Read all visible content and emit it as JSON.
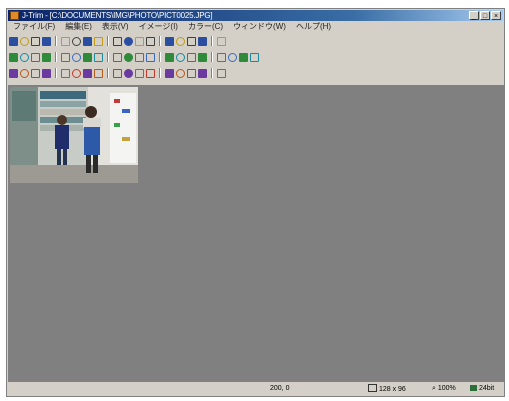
{
  "window": {
    "title": "J-Trim - [C:\\DOCUMENTS\\IMG\\PHOTO\\PICT0025.JPG]",
    "minimize": "_",
    "maximize": "□",
    "close": "×"
  },
  "menu": [
    "ファイル(F)",
    "編集(E)",
    "表示(V)",
    "イメージ(I)",
    "カラー(C)",
    "ウィンドウ(W)",
    "ヘルプ(H)"
  ],
  "toolbars": [
    [
      "new-icon",
      "open-icon",
      "save-icon",
      "print-icon",
      "cut-icon",
      "copy-icon",
      "paste-icon",
      "find-icon",
      "undo-icon",
      "redo-icon",
      "frame-icon",
      "text-icon",
      "line-icon",
      "grid-icon",
      "ruler-icon",
      "eyedropper-icon",
      "color-icon"
    ],
    [
      "select-icon",
      "rotate-icon",
      "flip-h-icon",
      "flip-v-icon",
      "arrow-icon",
      "resize-icon",
      "effect1-icon",
      "effect2-icon",
      "effect3-icon",
      "brightness-icon",
      "contrast-icon",
      "fill-icon",
      "mosaic-icon",
      "blur-icon",
      "sharpen-icon",
      "dot-icon",
      "border-icon",
      "brush-icon",
      "stamp-icon",
      "settings-icon"
    ],
    [
      "pencil-icon",
      "palette-icon",
      "flag-icon",
      "curve-icon",
      "rgb-icon",
      "swatch-icon",
      "image-icon",
      "filter-icon",
      "color-wheel-icon",
      "brush2-icon",
      "water-icon",
      "draw-icon",
      "spray-icon",
      "monitor-icon",
      "zoom-out-icon",
      "zoom-in-icon",
      "zoom-fit-icon"
    ]
  ],
  "status": {
    "coords": "200, 0",
    "size": "128 x 96",
    "zoom": "100%",
    "color": "24bit"
  },
  "colors": {
    "workspace": "#808080",
    "chrome": "#d4d0c8",
    "titlebar": "#0a246a"
  }
}
